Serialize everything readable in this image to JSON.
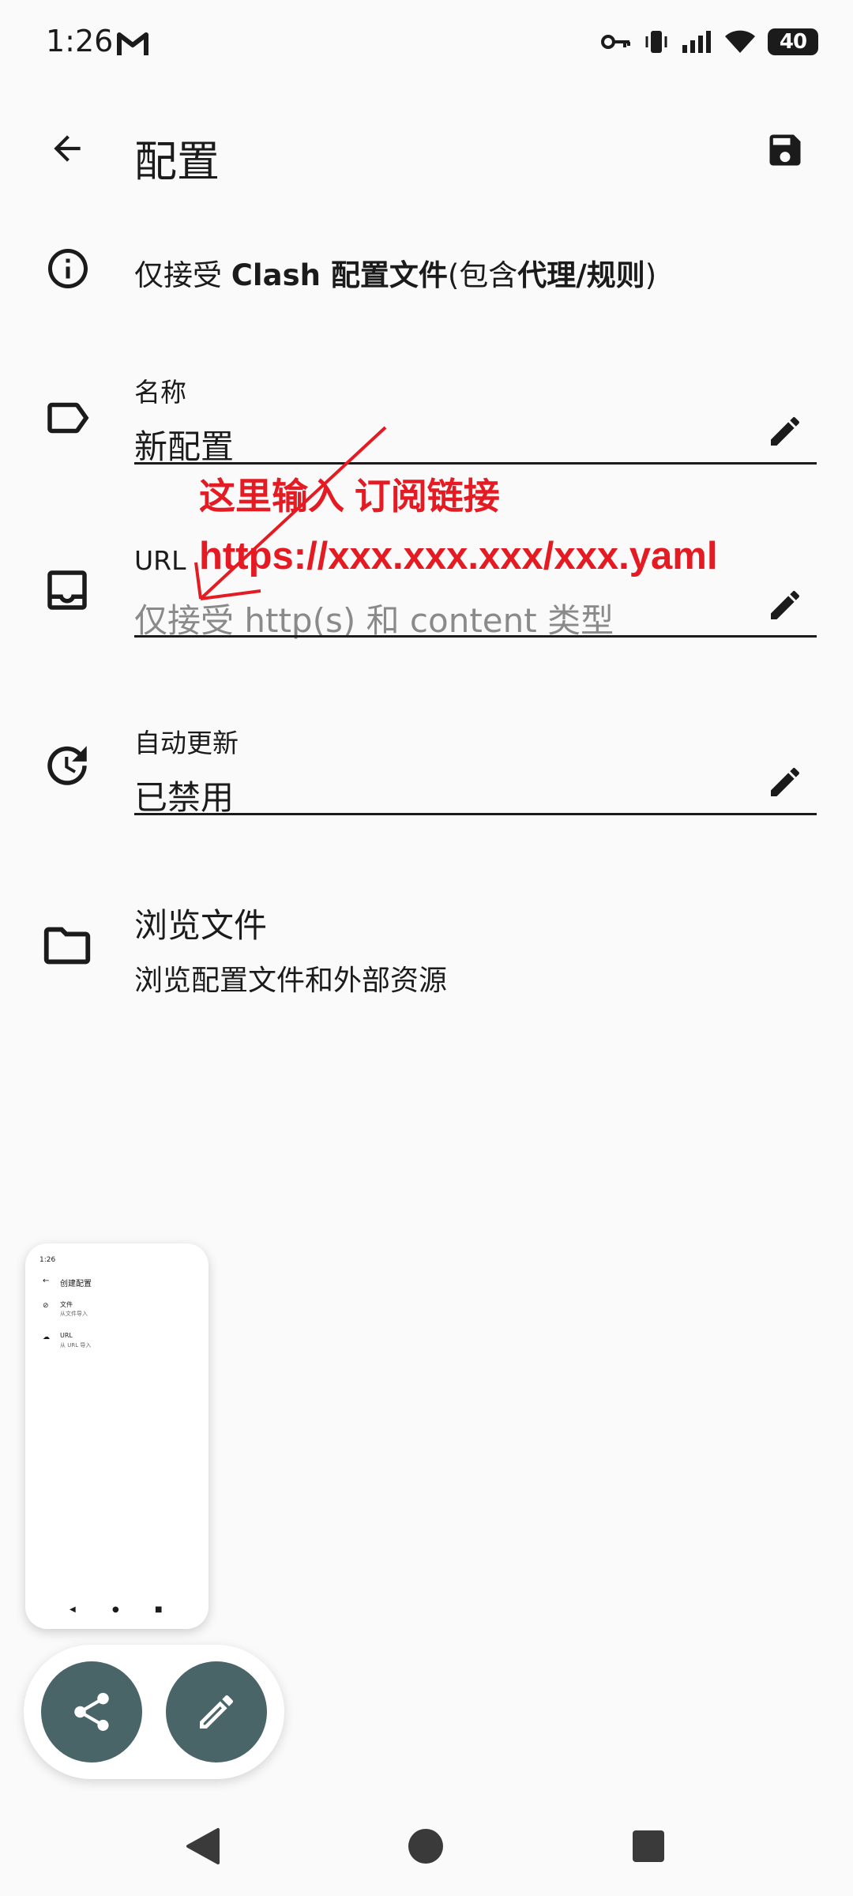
{
  "status_bar": {
    "time": "1:26",
    "battery": "40"
  },
  "app_bar": {
    "title": "配置"
  },
  "info": {
    "prefix": "仅接受 ",
    "clash": "Clash 配置文件",
    "open_paren": "(包含",
    "proxy_rules": "代理/规则",
    "close_paren": ")"
  },
  "name_field": {
    "label": "名称",
    "value": "新配置"
  },
  "url_field": {
    "label": "URL",
    "placeholder": "仅接受 http(s) 和 content 类型"
  },
  "auto_update": {
    "label": "自动更新",
    "value": "已禁用"
  },
  "browse_files": {
    "title": "浏览文件",
    "subtitle": "浏览配置文件和外部资源"
  },
  "annotation": {
    "line1": "这里输入 订阅链接",
    "line2": "https://xxx.xxx.xxx/xxx.yaml",
    "color": "#e41b23"
  },
  "thumbnail": {
    "time": "1:26",
    "title": "创建配置",
    "items": [
      {
        "label": "文件",
        "sub": "从文件导入"
      },
      {
        "label": "URL",
        "sub": "从 URL 导入"
      }
    ]
  },
  "colors": {
    "fab": "#4a6568",
    "background": "#fafafa"
  }
}
